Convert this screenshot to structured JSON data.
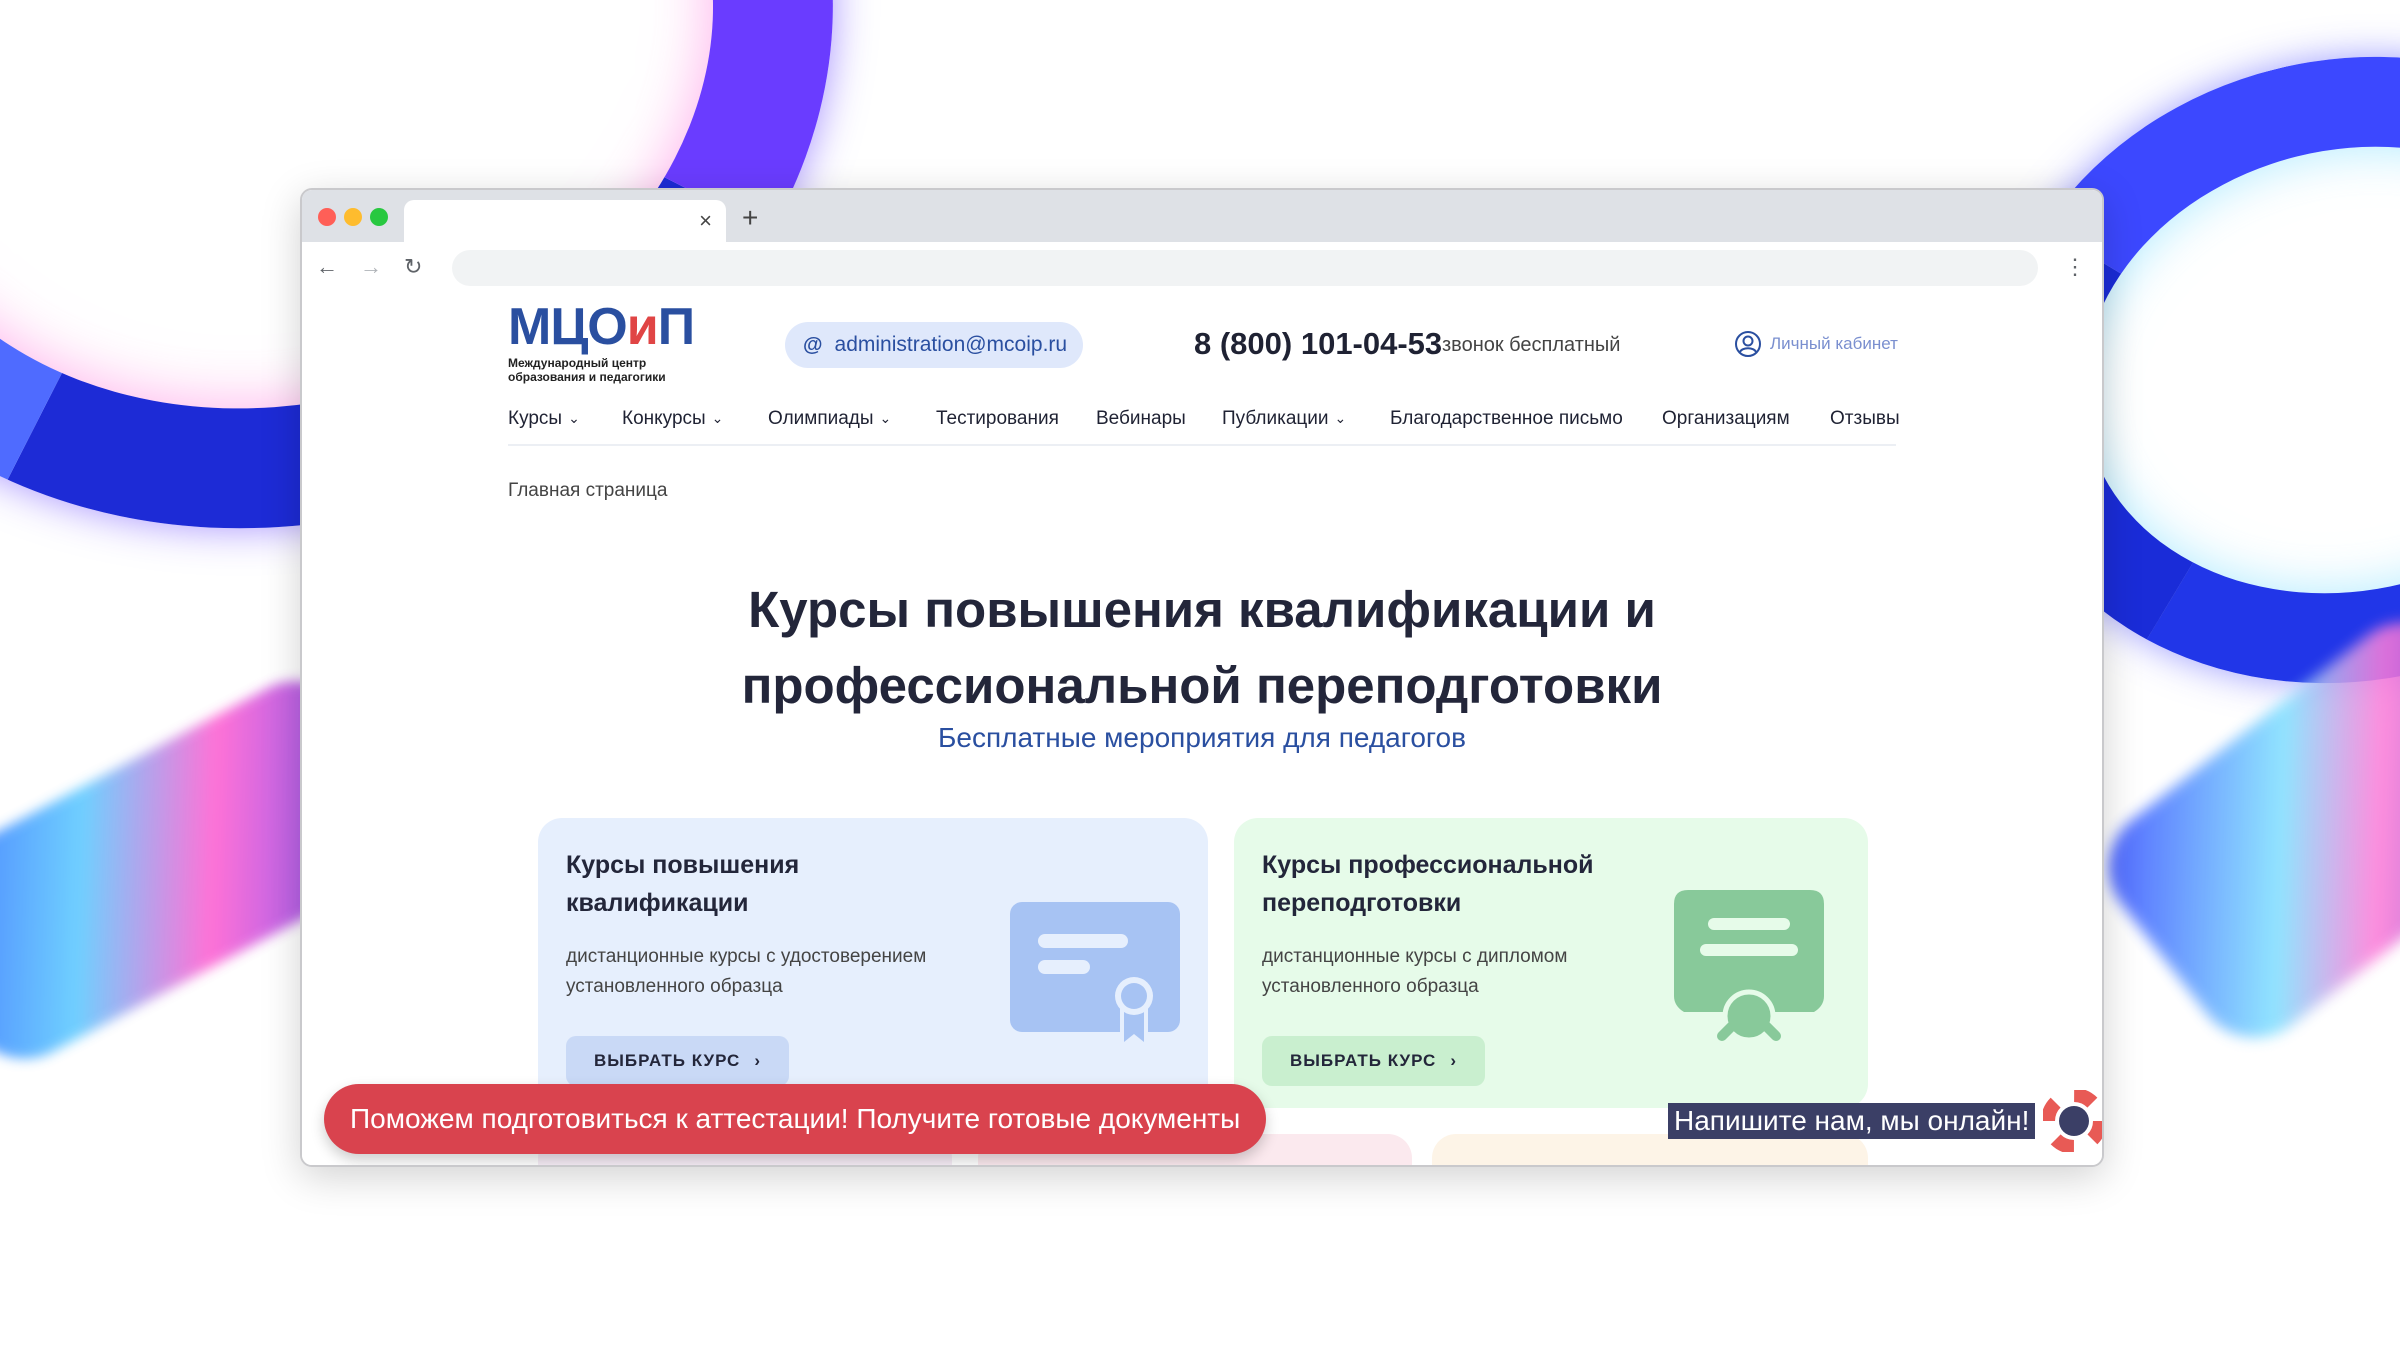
{
  "browser": {
    "tab_close": "×",
    "new_tab": "+",
    "back": "←",
    "forward": "→",
    "reload": "↻",
    "menu": "⋮"
  },
  "header": {
    "logo": {
      "main_a": "МЦО",
      "main_b": "и",
      "main_c": "П",
      "sub_line1": "Международный центр",
      "sub_line2": "образования и педагогики"
    },
    "email": "administration@mcoip.ru",
    "phone": "8 (800) 101-04-53",
    "phone_note": "звонок бесплатный",
    "cabinet": "Личный кабинет"
  },
  "nav": {
    "items": [
      {
        "label": "Курсы",
        "dropdown": true
      },
      {
        "label": "Конкурсы",
        "dropdown": true
      },
      {
        "label": "Олимпиады",
        "dropdown": true
      },
      {
        "label": "Тестирования",
        "dropdown": false
      },
      {
        "label": "Вебинары",
        "dropdown": false
      },
      {
        "label": "Публикации",
        "dropdown": true
      },
      {
        "label": "Благодарственное письмо",
        "dropdown": false
      },
      {
        "label": "Организациям",
        "dropdown": false
      },
      {
        "label": "Отзывы",
        "dropdown": false
      }
    ]
  },
  "breadcrumb": "Главная страница",
  "hero": {
    "title_line1": "Курсы повышения квалификации и",
    "title_line2": "профессиональной переподготовки",
    "subtitle": "Бесплатные мероприятия для педагогов"
  },
  "cards": [
    {
      "title_line1": "Курсы повышения",
      "title_line2": "квалификации",
      "desc_line1": "дистанционные курсы с удостоверением",
      "desc_line2": "установленного образца",
      "button": "ВЫБРАТЬ КУРС",
      "icon": "certificate-icon",
      "color": "#e6effd"
    },
    {
      "title_line1": "Курсы профессиональной",
      "title_line2": "переподготовки",
      "desc_line1": "дистанционные курсы с дипломом",
      "desc_line2": "установленного образца",
      "button": "ВЫБРАТЬ КУРС",
      "icon": "diploma-icon",
      "color": "#e6fbe9"
    }
  ],
  "promo": "Поможем подготовиться к аттестации! Получите готовые документы",
  "chat": "Напишите нам, мы онлайн!",
  "colors": {
    "brand_blue": "#2a4fa0",
    "brand_red": "#e04545",
    "promo_red": "#d9434e"
  }
}
